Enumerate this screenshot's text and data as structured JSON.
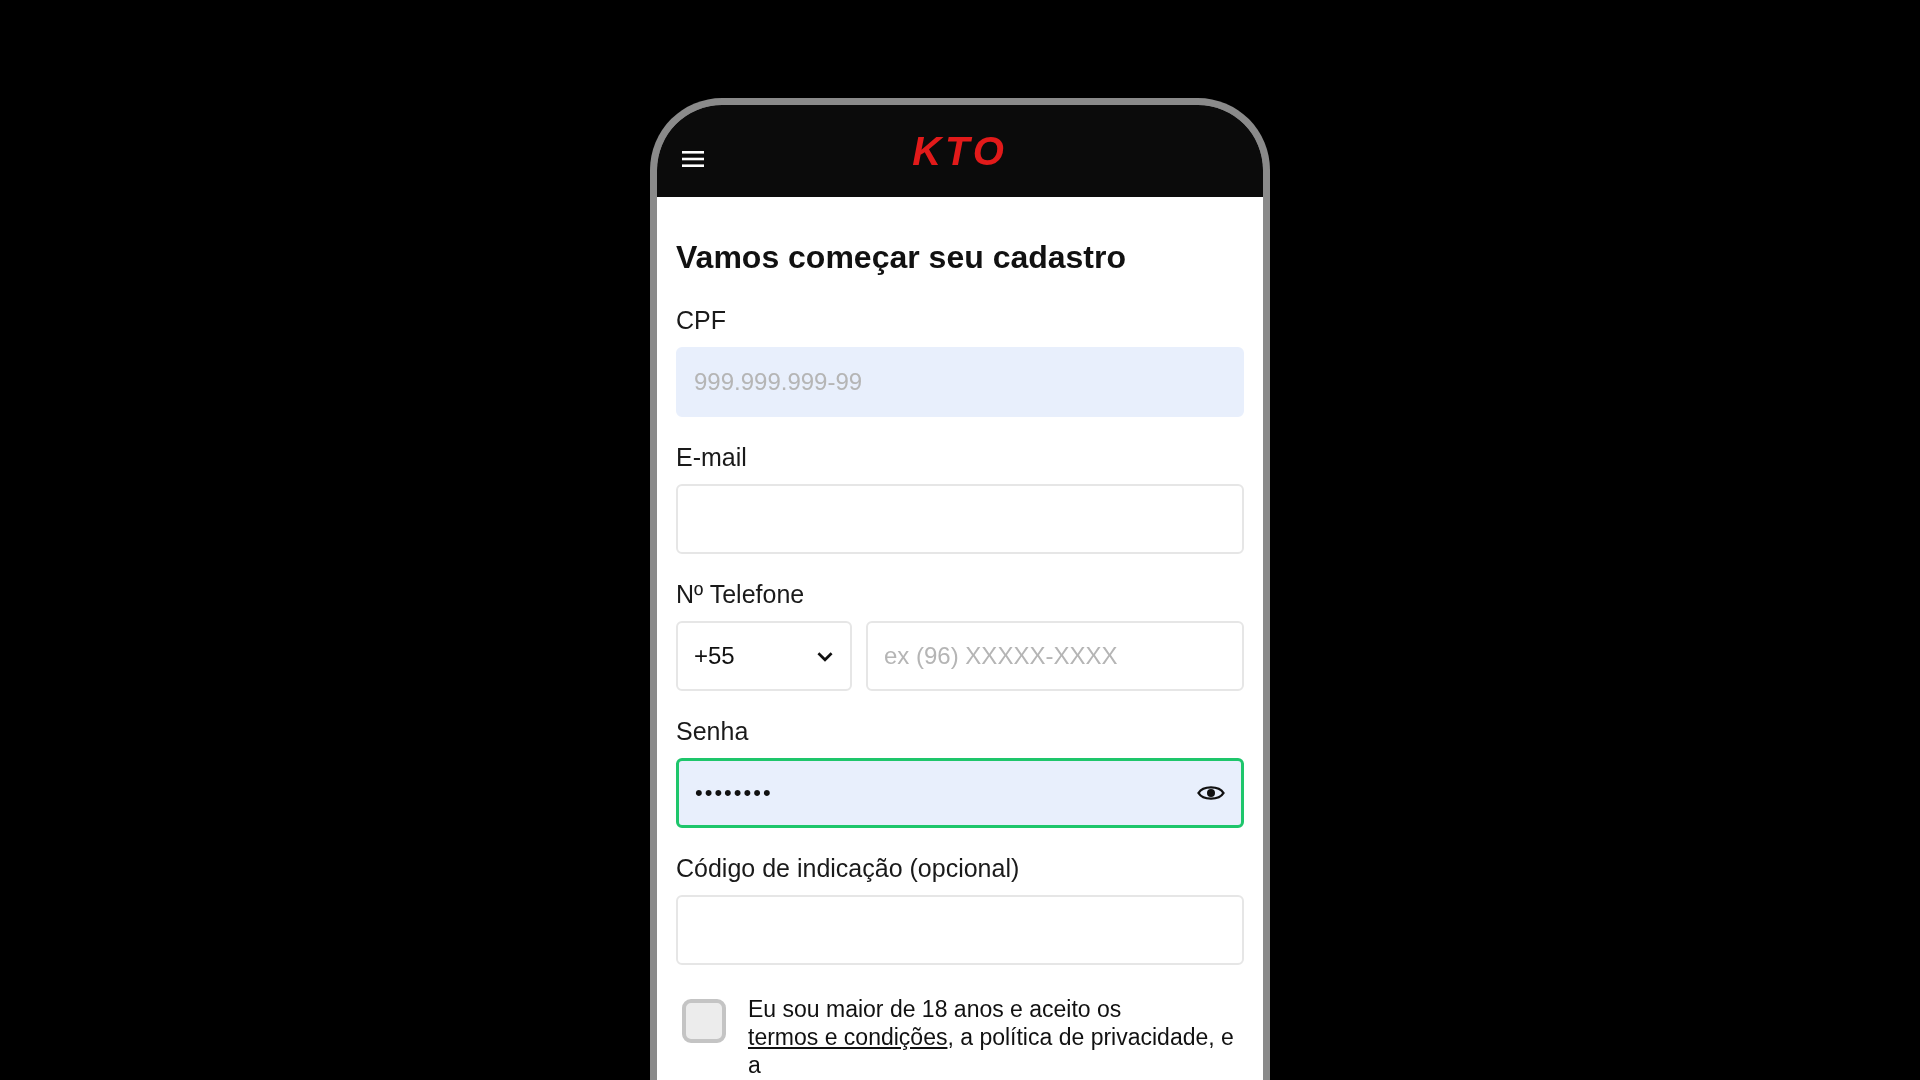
{
  "header": {
    "logo": "KTO"
  },
  "title": "Vamos começar seu cadastro",
  "fields": [
    {
      "kind": "text",
      "label": "CPF",
      "placeholder": "999.999.999-99",
      "autofill": true,
      "focused": false
    },
    {
      "kind": "text",
      "label": "E-mail",
      "autofill": false,
      "focused": false
    },
    {
      "kind": "phone",
      "label": "Nº Telefone",
      "country_code": "+55",
      "placeholder": "ex (96) XXXXX-XXXX",
      "autofill": false,
      "focused": false
    },
    {
      "kind": "password",
      "label": "Senha",
      "value": "••••••••",
      "autofill": true,
      "focused": true
    },
    {
      "kind": "text",
      "label": "Código de indicação (opcional)",
      "autofill": false,
      "focused": false
    }
  ],
  "consent": {
    "checked": false,
    "parts": [
      {
        "kind": "text",
        "text": "Eu sou maior de 18 anos e aceito os "
      },
      {
        "kind": "link",
        "text": "termos e condições"
      },
      {
        "kind": "text",
        "text": ", a política de privacidade, e a"
      }
    ]
  }
}
